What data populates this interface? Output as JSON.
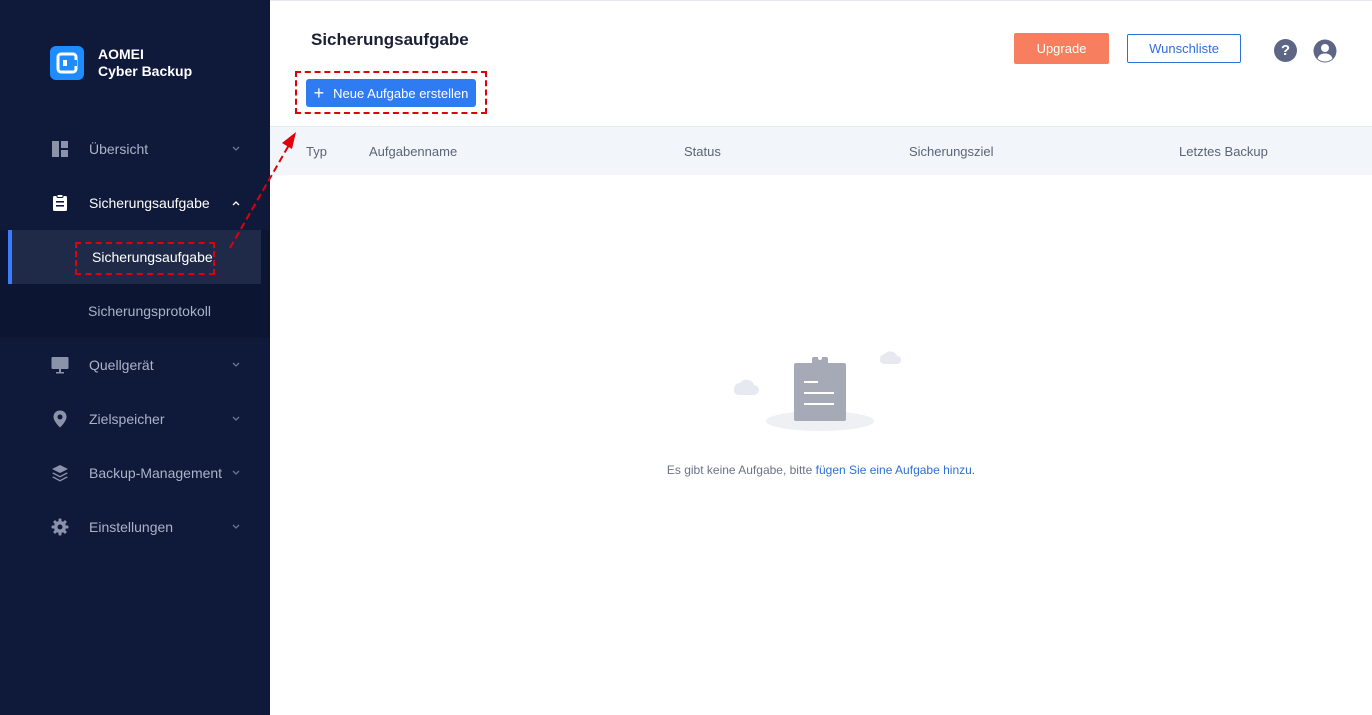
{
  "app": {
    "logo_line1": "AOMEI",
    "logo_line2": "Cyber Backup"
  },
  "sidebar": {
    "items": [
      {
        "label": "Übersicht",
        "icon": "dashboard-icon"
      },
      {
        "label": "Sicherungsaufgabe",
        "icon": "clipboard-icon"
      },
      {
        "label": "Quellgerät",
        "icon": "monitor-icon"
      },
      {
        "label": "Zielspeicher",
        "icon": "location-pin-icon"
      },
      {
        "label": "Backup-Management",
        "icon": "layers-icon"
      },
      {
        "label": "Einstellungen",
        "icon": "gear-icon"
      }
    ],
    "sub_items": [
      {
        "label": "Sicherungsaufgabe"
      },
      {
        "label": "Sicherungsprotokoll"
      }
    ]
  },
  "header": {
    "title": "Sicherungsaufgabe",
    "new_task_label": "Neue Aufgabe erstellen",
    "upgrade_label": "Upgrade",
    "wishlist_label": "Wunschliste",
    "help_glyph": "?"
  },
  "table": {
    "columns": [
      "Typ",
      "Aufgabenname",
      "Status",
      "Sicherungsziel",
      "Letztes Backup"
    ]
  },
  "empty_state": {
    "text": "Es gibt keine Aufgabe, bitte ",
    "link": "fügen Sie eine Aufgabe hinzu."
  },
  "colors": {
    "sidebar_bg": "#0f1a3a",
    "primary": "#2f7bf2",
    "upgrade": "#f77e5e",
    "annotation": "#e0000c"
  }
}
